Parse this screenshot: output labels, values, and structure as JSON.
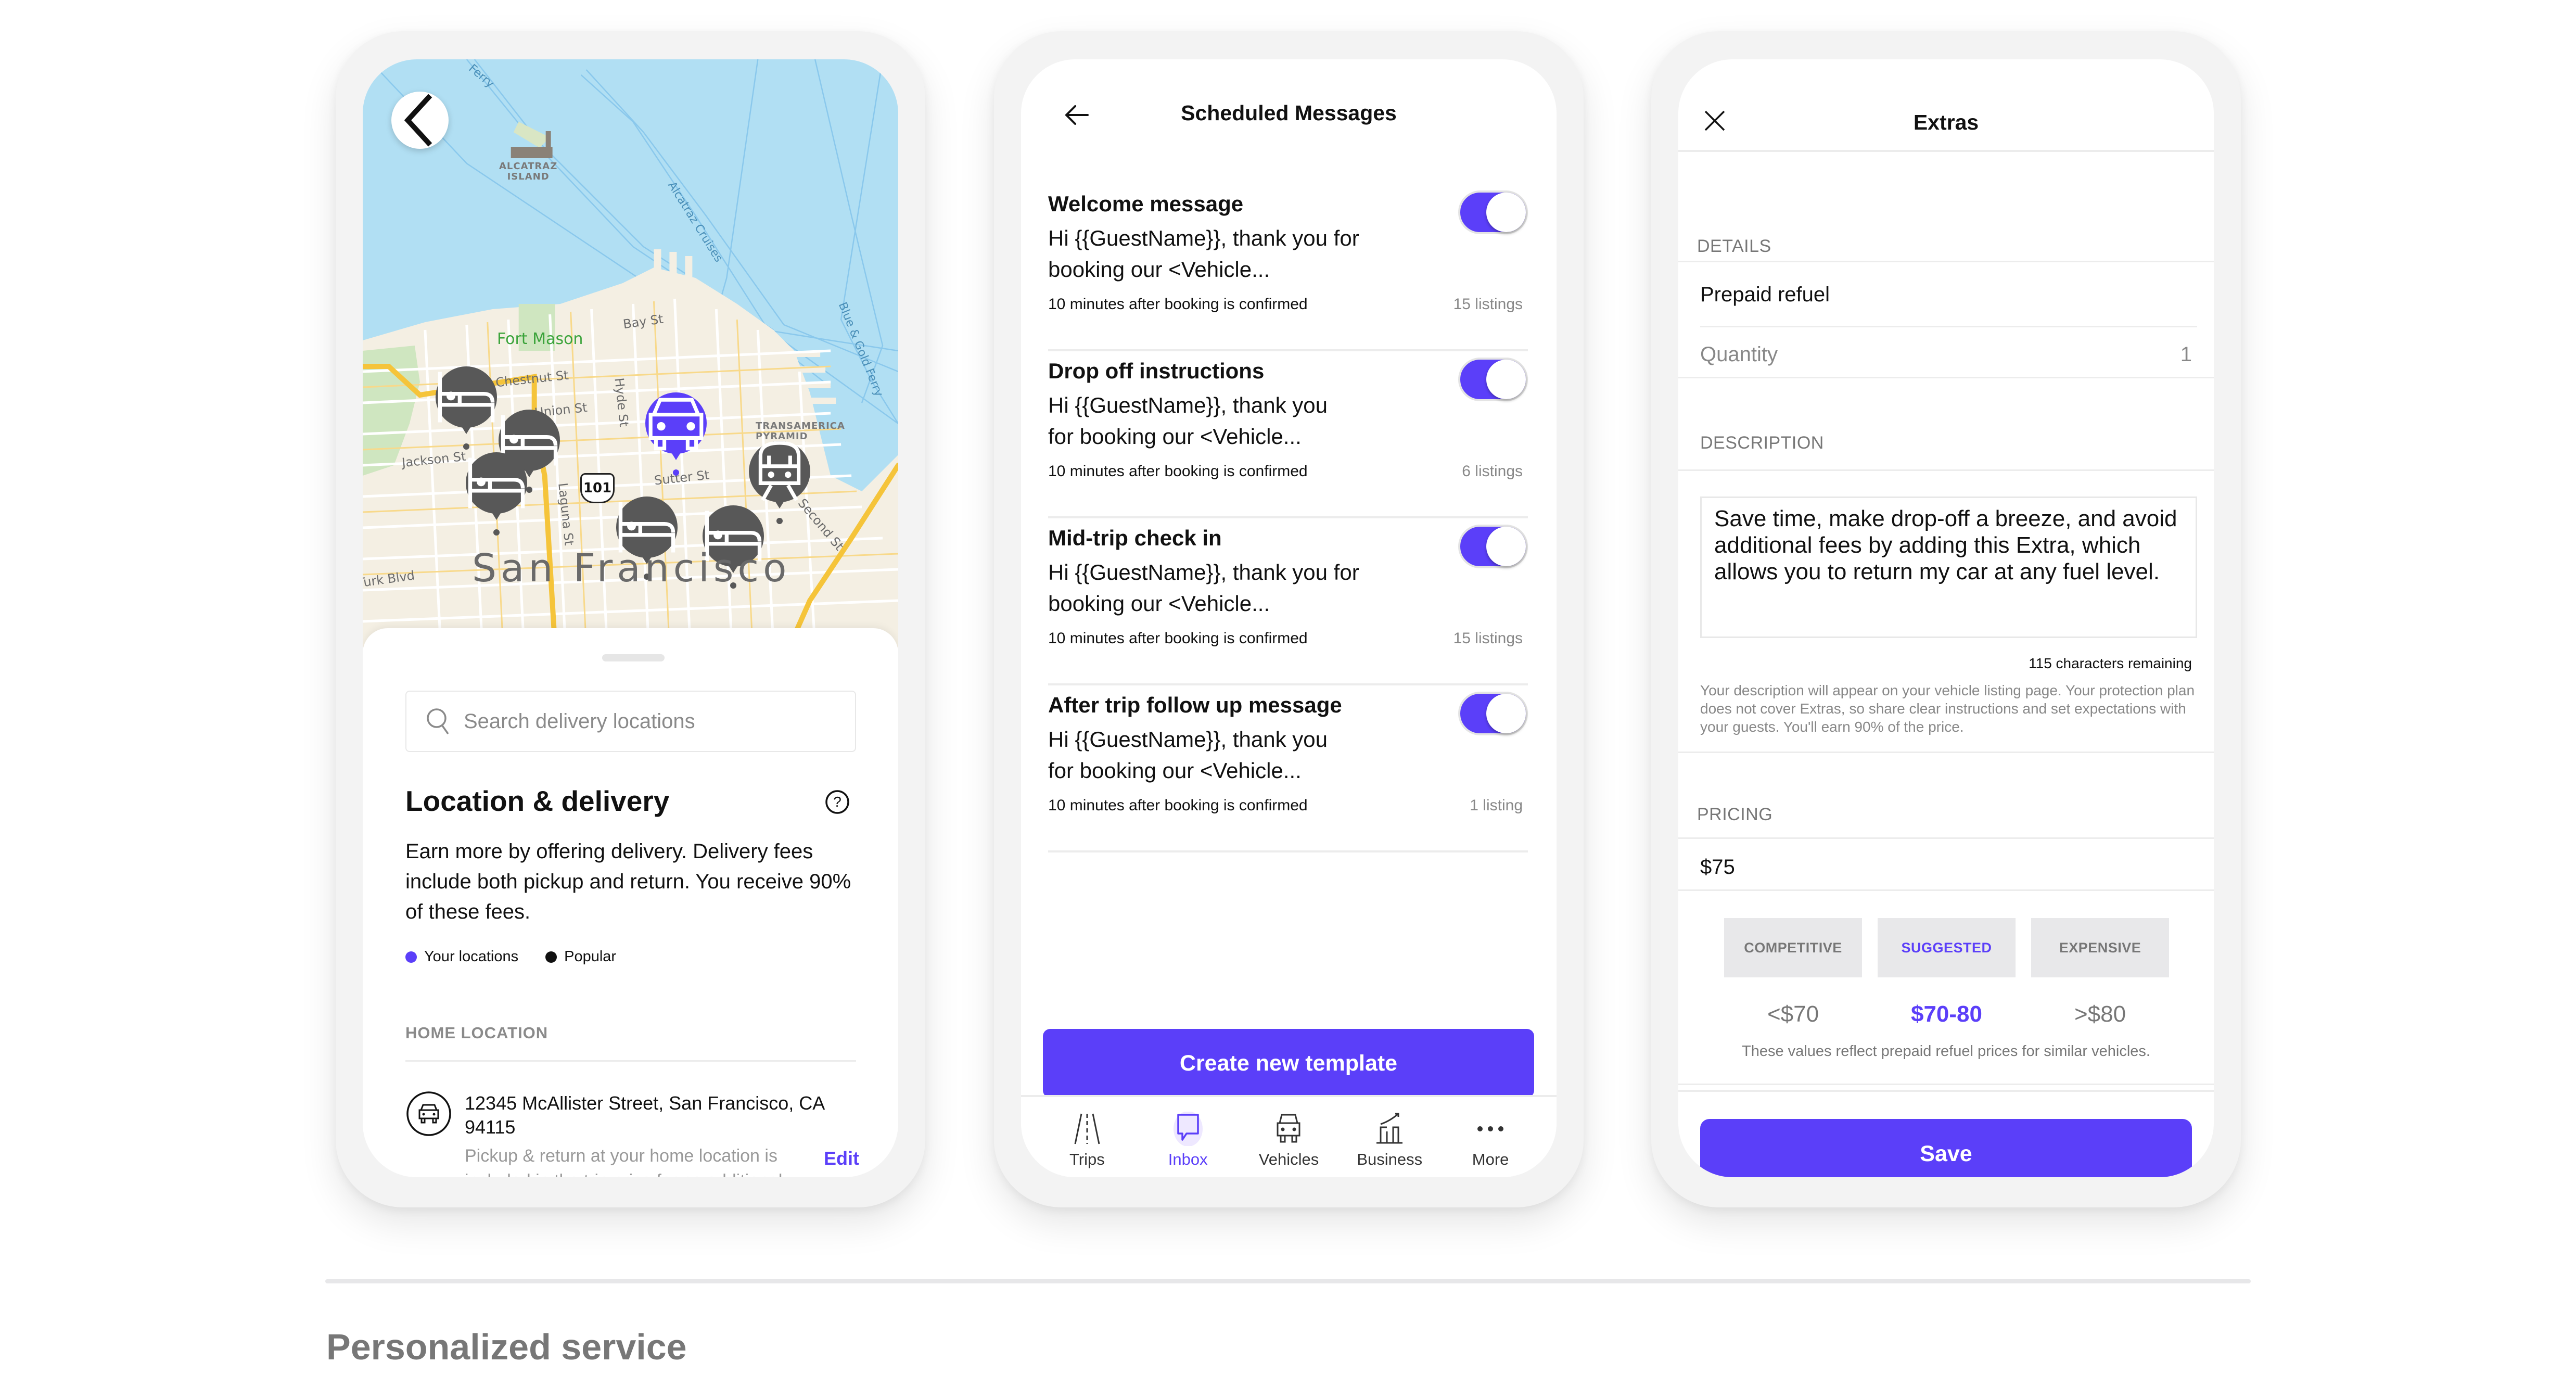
{
  "colors": {
    "accent": "#5b3ff9",
    "map_water": "#b1dff3",
    "pin": "#585858",
    "muted": "#888888"
  },
  "location_screen": {
    "map": {
      "city_label": "San Francisco",
      "park_label": "Fort Mason",
      "island_label_1": "ALCATRAZ",
      "island_label_2": "ISLAND",
      "landmark_label_1": "TRANSAMERICA",
      "landmark_label_2": "PYRAMID",
      "highway_shield": "101",
      "street_labels": [
        "Bay St",
        "Chestnut St",
        "Union St",
        "Jackson St",
        "Hyde St",
        "Laguna St",
        "Sutter St",
        "Second St",
        "Turk Blvd"
      ],
      "water_labels": [
        "Alcatraz Cruises",
        "Blue & Gold Ferry",
        "Ferry"
      ],
      "pins": [
        {
          "type": "hotel-icon",
          "active": false
        },
        {
          "type": "hotel-icon",
          "active": false
        },
        {
          "type": "hotel-icon",
          "active": false
        },
        {
          "type": "car-icon",
          "active": true
        },
        {
          "type": "train-icon",
          "active": false
        },
        {
          "type": "hotel-icon",
          "active": false
        },
        {
          "type": "hotel-icon",
          "active": false
        }
      ]
    },
    "search": {
      "placeholder": "Search delivery locations"
    },
    "title": "Location & delivery",
    "description": "Earn more by offering delivery. Delivery fees include both pickup and return. You receive 90% of these fees.",
    "legend": [
      {
        "label": "Your locations",
        "color": "#5b3ff9"
      },
      {
        "label": "Popular",
        "color": "#111111"
      }
    ],
    "home_section_label": "HOME LOCATION",
    "home_address": "12345 McAllister Street, San Francisco, CA 94115",
    "home_note": "Pickup & return at your home location is included in the trip price for no additional fee.",
    "edit_label": "Edit"
  },
  "messages_screen": {
    "title": "Scheduled Messages",
    "messages": [
      {
        "title": "Welcome message",
        "body": "Hi {{GuestName}}, thank you for booking our <Vehicle...",
        "schedule": "10 minutes after booking is confirmed",
        "count": "15 listings",
        "enabled": true
      },
      {
        "title": "Drop off instructions",
        "body": "Hi {{GuestName}}, thank you for booking our <Vehicle...",
        "schedule": "10 minutes after booking is confirmed",
        "count": "6 listings",
        "enabled": true
      },
      {
        "title": "Mid-trip check in",
        "body": "Hi {{GuestName}}, thank you for booking our <Vehicle...",
        "schedule": "10 minutes after booking is confirmed",
        "count": "15 listings",
        "enabled": true
      },
      {
        "title": "After trip follow up message",
        "body": "Hi {{GuestName}}, thank you for booking our <Vehicle...",
        "schedule": "10 minutes after booking is confirmed",
        "count": "1 listing",
        "enabled": true
      }
    ],
    "create_button": "Create new template",
    "tabs": [
      {
        "label": "Trips",
        "icon": "road-icon",
        "active": false
      },
      {
        "label": "Inbox",
        "icon": "chat-bubble-icon",
        "active": true
      },
      {
        "label": "Vehicles",
        "icon": "car-icon",
        "active": false
      },
      {
        "label": "Business",
        "icon": "chart-icon",
        "active": false
      },
      {
        "label": "More",
        "icon": "more-dots-icon",
        "active": false
      }
    ]
  },
  "extras_screen": {
    "title": "Extras",
    "details_label": "DETAILS",
    "name_value": "Prepaid refuel",
    "quantity_label": "Quantity",
    "quantity_value": "1",
    "description_label": "DESCRIPTION",
    "description_value": "Save time, make drop-off a breeze, and avoid additional fees by adding this Extra, which allows you to return my car at any fuel level.",
    "characters_remaining": "115 characters remaining",
    "description_help": "Your description will appear on your vehicle listing page. Your protection plan does not cover Extras, so share clear instructions and set expectations with your guests. You'll earn 90% of the price.",
    "pricing_label": "PRICING",
    "price_value": "$75",
    "tiers": [
      {
        "label": "COMPETITIVE",
        "value": "<$70",
        "highlighted": false
      },
      {
        "label": "SUGGESTED",
        "value": "$70-80",
        "highlighted": true
      },
      {
        "label": "EXPENSIVE",
        "value": ">$80",
        "highlighted": false
      }
    ],
    "tiers_note": "These values reflect prepaid refuel prices for similar vehicles.",
    "save_button": "Save"
  },
  "page": {
    "section_heading": "Personalized service"
  }
}
